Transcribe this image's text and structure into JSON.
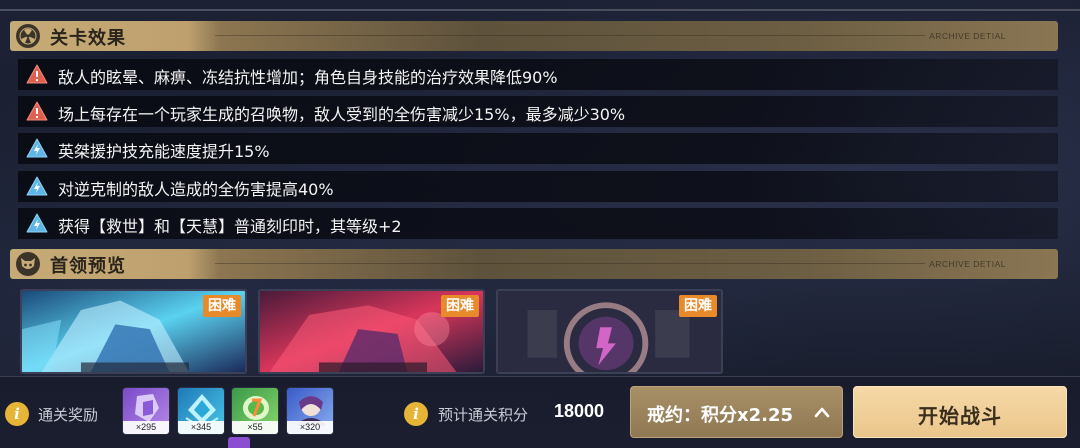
{
  "stage_effects": {
    "title": "关卡效果",
    "archive_label": "ARCHIVE DETIAL",
    "items": [
      {
        "type": "debuff",
        "icon": "warning-icon",
        "text": "敌人的眩晕、麻痹、冻结抗性增加；角色自身技能的治疗效果降低90%"
      },
      {
        "type": "debuff",
        "icon": "warning-icon",
        "text": "场上每存在一个玩家生成的召唤物，敌人受到的全伤害减少15%，最多减少30%"
      },
      {
        "type": "buff",
        "icon": "lightning-icon",
        "text": "英桀援护技充能速度提升15%"
      },
      {
        "type": "buff",
        "icon": "lightning-icon",
        "text": "对逆克制的敌人造成的全伤害提高40%"
      },
      {
        "type": "buff",
        "icon": "lightning-icon",
        "text": "获得【救世】和【天慧】普通刻印时，其等级+2"
      }
    ]
  },
  "boss_preview": {
    "title": "首领预览",
    "archive_label": "ARCHIVE DETIAL",
    "bosses": [
      {
        "difficulty": "困难",
        "theme": "cyan-mech"
      },
      {
        "difficulty": "困难",
        "theme": "red-mech"
      },
      {
        "difficulty": "困难",
        "theme": "ring-core"
      }
    ]
  },
  "bottom_bar": {
    "reward_label": "通关奖励",
    "rewards": [
      {
        "qty": "×295",
        "icon": "purple-crystal-icon"
      },
      {
        "qty": "×345",
        "icon": "blue-gem-icon"
      },
      {
        "qty": "×55",
        "icon": "green-chip-icon"
      },
      {
        "qty": "×320",
        "icon": "valkyrie-portrait-icon"
      }
    ],
    "score_label": "预计通关积分",
    "score_value": "18000",
    "pledge_button": "戒约：积分x2.25",
    "start_button": "开始战斗"
  },
  "colors": {
    "gold_header": "#c7ab77",
    "debuff_icon": "#e0604f",
    "buff_icon": "#5fb6e6",
    "badge": "#e88a2a",
    "start_button": "#eac68b"
  }
}
